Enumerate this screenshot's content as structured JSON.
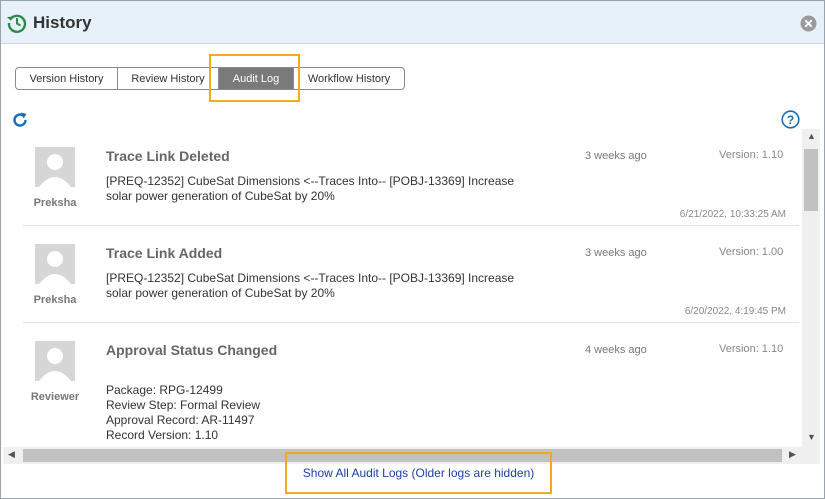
{
  "header": {
    "title": "History",
    "icon": "history-clock-icon",
    "close_icon": "close-circle-icon"
  },
  "tabs": [
    {
      "label": "Version History",
      "active": false
    },
    {
      "label": "Review History",
      "active": false
    },
    {
      "label": "Audit Log",
      "active": true
    },
    {
      "label": "Workflow History",
      "active": false
    }
  ],
  "toolbar": {
    "refresh_icon": "refresh-icon",
    "help_icon": "help-icon"
  },
  "entries": [
    {
      "user": "Preksha",
      "title": "Trace Link Deleted",
      "ago": "3 weeks ago",
      "version": "Version: 1.10",
      "lines": [
        "[PREQ-12352] CubeSat Dimensions <--Traces Into-- [POBJ-13369] Increase",
        "solar power generation of CubeSat by 20%"
      ],
      "datetime": "6/21/2022, 10:33:25 AM"
    },
    {
      "user": "Preksha",
      "title": "Trace Link Added",
      "ago": "3 weeks ago",
      "version": "Version: 1.00",
      "lines": [
        "[PREQ-12352] CubeSat Dimensions <--Traces Into-- [POBJ-13369] Increase",
        "solar power generation of CubeSat by 20%"
      ],
      "datetime": "6/20/2022, 4:19:45 PM"
    },
    {
      "user": "Reviewer",
      "title": "Approval Status Changed",
      "ago": "4 weeks ago",
      "version": "Version: 1.10",
      "lines": [
        "Package: RPG-12499",
        "Review Step: Formal Review",
        "Approval Record: AR-11497",
        "Record Version: 1.10"
      ],
      "datetime": ""
    }
  ],
  "footer": {
    "show_all_label": "Show All Audit Logs (Older logs are hidden)"
  },
  "colors": {
    "accent": "#1a6fb5",
    "highlight": "#f2a91e",
    "active_tab": "#7a7a7a",
    "header_bg": "#e6f1f9"
  }
}
